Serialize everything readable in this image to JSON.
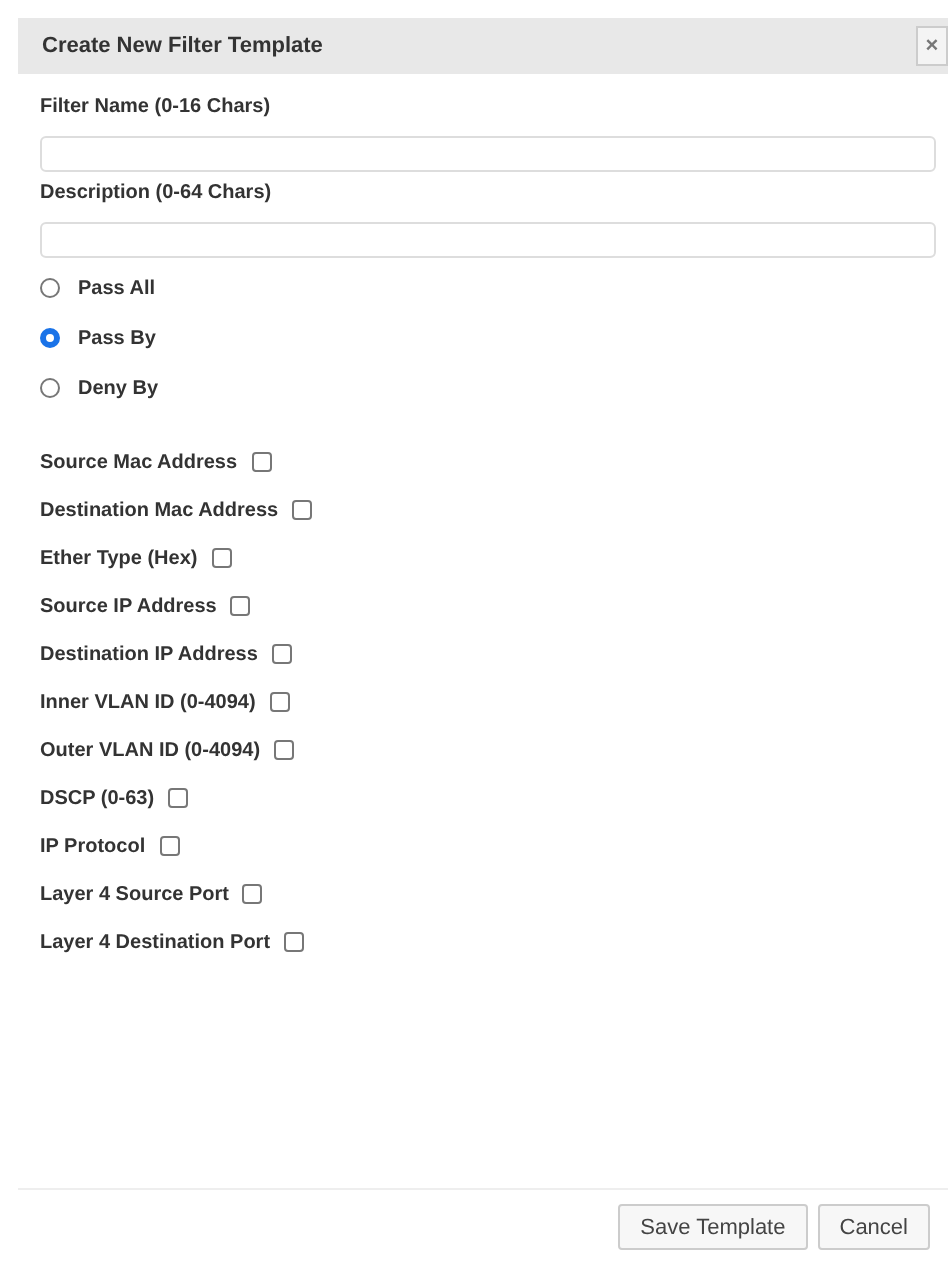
{
  "dialog": {
    "title": "Create New Filter Template",
    "close": "×"
  },
  "fields": [
    {
      "label": "Filter Name (0-16 Chars)"
    },
    {
      "label": "Description (0-64 Chars)"
    }
  ],
  "actions": [
    {
      "label": "Pass All",
      "selected": false
    },
    {
      "label": "Pass By",
      "selected": true
    },
    {
      "label": "Deny By",
      "selected": false
    }
  ],
  "criteria": [
    {
      "label": "Source Mac Address",
      "checked": false
    },
    {
      "label": "Destination Mac Address",
      "checked": false
    },
    {
      "label": "Ether Type (Hex)",
      "checked": false
    },
    {
      "label": "Source IP Address",
      "checked": false
    },
    {
      "label": "Destination IP Address",
      "checked": false
    },
    {
      "label": "Inner VLAN ID (0-4094)",
      "checked": false
    },
    {
      "label": "Outer VLAN ID (0-4094)",
      "checked": false
    },
    {
      "label": "DSCP (0-63)",
      "checked": false
    },
    {
      "label": "IP Protocol",
      "checked": false
    },
    {
      "label": "Layer 4 Source Port",
      "checked": false
    },
    {
      "label": "Layer 4 Destination Port",
      "checked": false
    }
  ],
  "buttons": [
    "Save Template",
    "Cancel"
  ]
}
